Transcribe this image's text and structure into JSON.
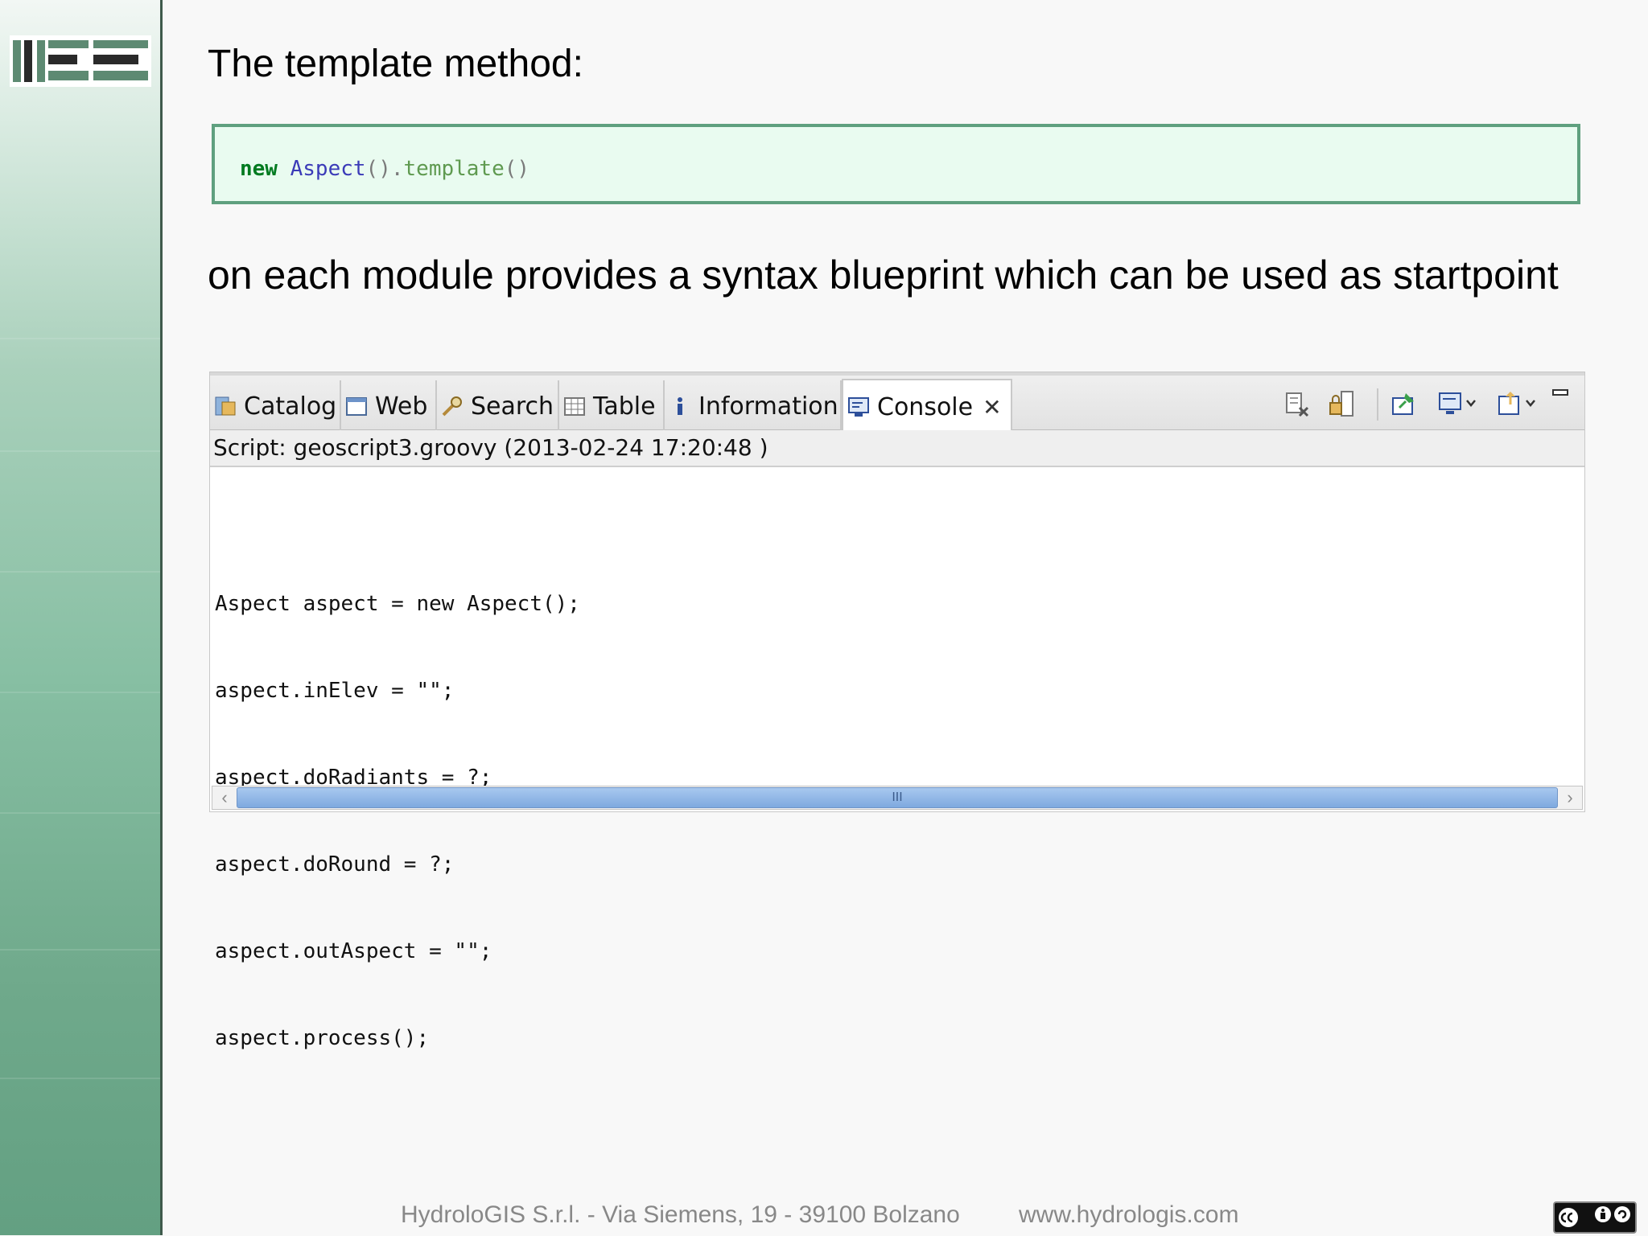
{
  "slide": {
    "title": "The template method:",
    "code": {
      "keyword": "new",
      "class_name": "Aspect",
      "p1": "().",
      "method": "template",
      "p2": "()"
    },
    "body": "on each module provides a syntax blueprint which can be used as startpoint"
  },
  "panel": {
    "tabs": [
      {
        "label": "Catalog",
        "icon": "catalog-icon"
      },
      {
        "label": "Web",
        "icon": "window-icon"
      },
      {
        "label": "Search",
        "icon": "search-icon"
      },
      {
        "label": "Table",
        "icon": "table-icon"
      },
      {
        "label": "Information",
        "icon": "info-icon"
      },
      {
        "label": "Console",
        "icon": "console-icon",
        "active": true
      }
    ],
    "close_glyph": "✕",
    "script_info": "Script: geoscript3.groovy (2013-02-24 17:20:48 )",
    "console_lines": [
      "Aspect aspect = new Aspect();",
      "aspect.inElev = \"\";",
      "aspect.doRadiants = ?;",
      "aspect.doRound = ?;",
      "aspect.outAspect = \"\";",
      "aspect.process();"
    ],
    "scroll": {
      "left": "‹",
      "right": "›",
      "grip": "III"
    }
  },
  "footer": {
    "company": "HydroloGIS S.r.l. - Via Siemens, 19 - 39100 Bolzano",
    "website": "www.hydrologis.com"
  },
  "colors": {
    "accent_green": "#5fa07f",
    "code_bg": "#e9fbf0",
    "keyword": "#007a20"
  }
}
